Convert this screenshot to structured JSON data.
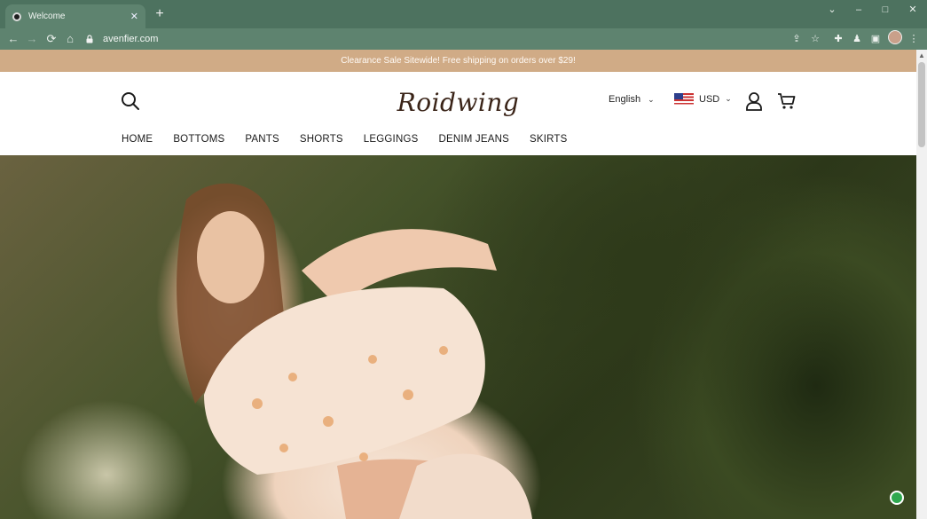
{
  "browser": {
    "tab_title": "Welcome",
    "new_tab_label": "+",
    "url": "avenfier.com"
  },
  "site": {
    "announcement": "Clearance Sale Sitewide! Free shipping on orders over $29!",
    "logo": "Roidwing",
    "language": "English",
    "currency": "USD",
    "nav": [
      "HOME",
      "BOTTOMS",
      "PANTS",
      "SHORTS",
      "LEGGINGS",
      "DENIM JEANS",
      "SKIRTS"
    ]
  },
  "colors": {
    "announcement_bg": "#d0ab86",
    "chrome": "#5e836f"
  },
  "icons": {
    "search": "search-icon",
    "account": "user-icon",
    "cart": "cart-icon",
    "help": "help-icon"
  }
}
